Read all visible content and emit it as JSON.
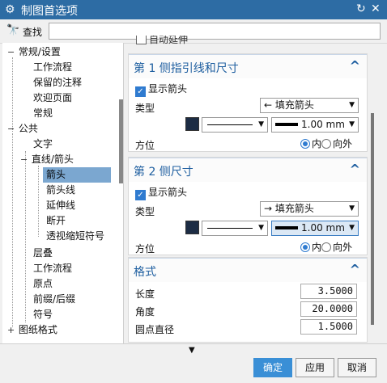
{
  "window": {
    "title": "制图首选项",
    "reset_icon": "reset-icon",
    "close_icon": "close-icon"
  },
  "find": {
    "label": "查找",
    "value": ""
  },
  "tree": [
    {
      "label": "常规/设置",
      "exp": "−"
    },
    {
      "label": "工作流程"
    },
    {
      "label": "保留的注释"
    },
    {
      "label": "欢迎页面"
    },
    {
      "label": "常规"
    },
    {
      "label": "公共",
      "exp": "−"
    },
    {
      "label": "文字"
    },
    {
      "label": "直线/箭头",
      "exp": "−"
    },
    {
      "label": "箭头",
      "selected": true
    },
    {
      "label": "箭头线"
    },
    {
      "label": "延伸线"
    },
    {
      "label": "断开"
    },
    {
      "label": "透视缩短符号"
    },
    {
      "label": "层叠"
    },
    {
      "label": "工作流程"
    },
    {
      "label": "原点"
    },
    {
      "label": "前缀/后缀"
    },
    {
      "label": "符号"
    },
    {
      "label": "图纸格式",
      "exp": "+"
    }
  ],
  "top_partial_label": "自动延伸",
  "side1": {
    "title": "第 1 侧指引线和尺寸",
    "show_arrow": "显示箭头",
    "type_label": "类型",
    "type_value": "← 填充箭头",
    "line_width": "1.00 mm",
    "direction_label": "方位",
    "opt_in": "内",
    "opt_out": "向外"
  },
  "side2": {
    "title": "第 2 侧尺寸",
    "show_arrow": "显示箭头",
    "type_label": "类型",
    "type_value": "→ 填充箭头",
    "line_width": "1.00 mm",
    "direction_label": "方位",
    "opt_in": "内",
    "opt_out": "向外"
  },
  "format": {
    "title": "格式",
    "length_label": "长度",
    "length_value": "3.5000",
    "angle_label": "角度",
    "angle_value": "20.0000",
    "dot_label": "圆点直径",
    "dot_value": "1.5000"
  },
  "buttons": {
    "ok": "确定",
    "apply": "应用",
    "cancel": "取消"
  },
  "colors": {
    "titlebar": "#2d6ca4",
    "accent": "#2f7bd0",
    "swatch": "#1c2c44",
    "selected": "#7ba7d0"
  }
}
